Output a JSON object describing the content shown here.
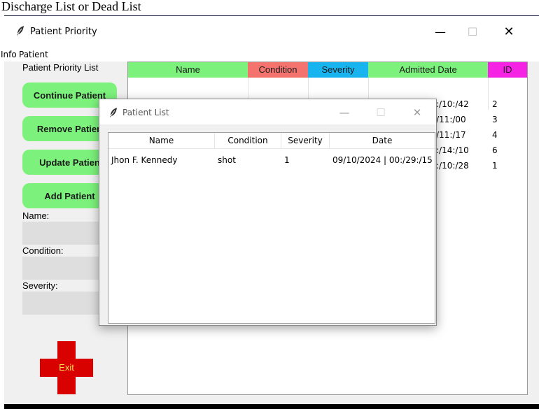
{
  "caption": "Discharge List or Dead List",
  "window": {
    "title": "Patient Priority",
    "minimize": "—",
    "maximize": "☐",
    "close": "✕"
  },
  "menu": {
    "info": "Info",
    "patient": "Patient"
  },
  "left": {
    "heading": "Patient Priority List",
    "continue": "Continue Patient",
    "remove": "Remove Patien",
    "update": "Update Patien",
    "add": "Add Patient",
    "name_label": "Name:",
    "condition_label": "Condition:",
    "severity_label": "Severity:",
    "exit": "Exit"
  },
  "table": {
    "headers": [
      "Name",
      "Condition",
      "Severity",
      "Admitted Date",
      "ID"
    ],
    "header_colors": [
      "#7cf27c",
      "#f4736e",
      "#18b4ef",
      "#7cf27c",
      "#f524e5"
    ],
    "rows": [
      {
        "time": ":/10:/42",
        "id": "2"
      },
      {
        "time": "/11:/00",
        "id": "3"
      },
      {
        "time": "/11:/17",
        "id": "4"
      },
      {
        "time": ":/14:/10",
        "id": "6"
      },
      {
        "time": ":/10:/28",
        "id": "1"
      }
    ]
  },
  "dialog": {
    "title": "Patient List",
    "minimize": "—",
    "maximize": "☐",
    "close": "✕",
    "headers": [
      "Name",
      "Condition",
      "Severity",
      "Date"
    ],
    "row": {
      "name": "Jhon F. Kennedy",
      "condition": "shot",
      "severity": "1",
      "date": "09/10/2024 | 00:/29:/15"
    }
  }
}
